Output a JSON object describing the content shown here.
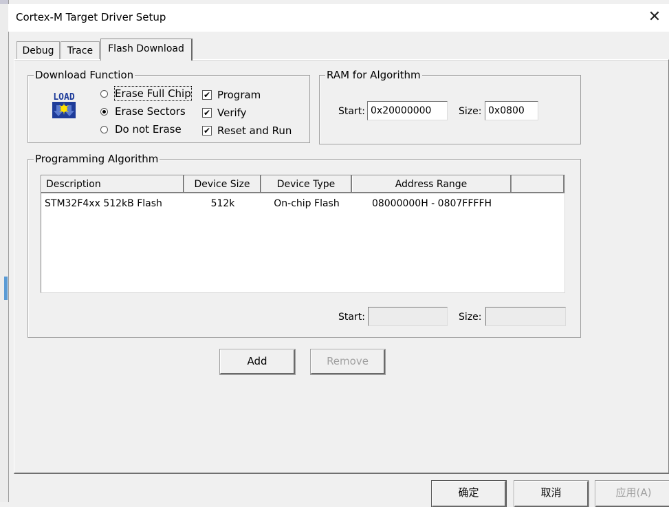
{
  "window": {
    "title": "Cortex-M Target Driver Setup",
    "close_glyph": "✕"
  },
  "tabs": [
    {
      "label": "Debug"
    },
    {
      "label": "Trace"
    },
    {
      "label": "Flash Download",
      "active": true
    }
  ],
  "download_function": {
    "title": "Download Function",
    "icon": "load-icon",
    "icon_text": "LOAD",
    "erase_options": [
      {
        "label": "Erase Full Chip",
        "selected": false
      },
      {
        "label": "Erase Sectors",
        "selected": true
      },
      {
        "label": "Do not Erase",
        "selected": false
      }
    ],
    "checks": [
      {
        "label": "Program",
        "checked": true
      },
      {
        "label": "Verify",
        "checked": true
      },
      {
        "label": "Reset and Run",
        "checked": true
      }
    ]
  },
  "ram": {
    "title": "RAM for Algorithm",
    "start_label": "Start:",
    "start_value": "0x20000000",
    "size_label": "Size:",
    "size_value": "0x0800"
  },
  "algorithm": {
    "title": "Programming Algorithm",
    "columns": [
      "Description",
      "Device Size",
      "Device Type",
      "Address Range"
    ],
    "rows": [
      {
        "description": "STM32F4xx 512kB Flash",
        "device_size": "512k",
        "device_type": "On-chip Flash",
        "address_range": "08000000H - 0807FFFFH"
      }
    ],
    "start_label": "Start:",
    "start_value": "",
    "size_label": "Size:",
    "size_value": ""
  },
  "buttons": {
    "add": "Add",
    "remove": "Remove",
    "ok": "确定",
    "cancel": "取消",
    "apply": "应用(A)"
  },
  "colors": {
    "accent": "#5a9bd5",
    "icon_blue": "#1e3c9a",
    "icon_yellow": "#ffe100"
  }
}
